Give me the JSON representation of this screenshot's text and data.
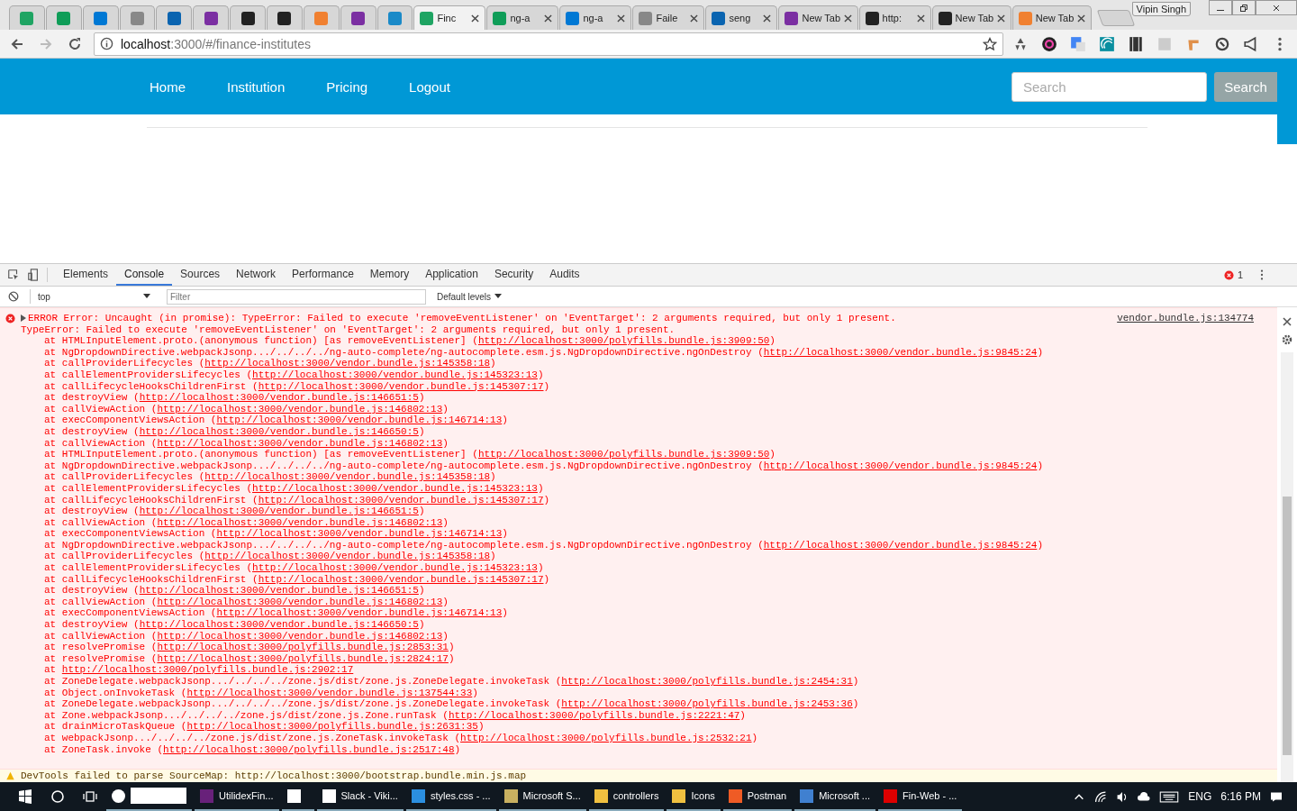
{
  "browser": {
    "tabs": [
      {
        "kind": "pinned",
        "selected": false
      },
      {
        "kind": "pinned",
        "selected": false
      },
      {
        "kind": "pinned",
        "selected": false
      },
      {
        "kind": "pinned",
        "selected": false
      },
      {
        "kind": "pinned",
        "selected": false
      },
      {
        "kind": "pinned",
        "selected": false
      },
      {
        "kind": "pinned",
        "selected": false
      },
      {
        "kind": "pinned",
        "selected": false
      },
      {
        "kind": "pinned",
        "selected": false
      },
      {
        "kind": "pinned",
        "selected": false
      },
      {
        "kind": "pinned",
        "selected": false
      },
      {
        "kind": "tab",
        "title": "Finc",
        "selected": true
      },
      {
        "kind": "tab",
        "title": "ng-a",
        "selected": false
      },
      {
        "kind": "tab",
        "title": "ng-a",
        "selected": false
      },
      {
        "kind": "tab",
        "title": "Faile",
        "selected": false
      },
      {
        "kind": "tab",
        "title": "seng",
        "selected": false
      },
      {
        "kind": "tab",
        "title": "New Tab",
        "selected": false
      },
      {
        "kind": "tab",
        "title": "http:",
        "selected": false
      },
      {
        "kind": "tab",
        "title": "New Tab",
        "selected": false
      },
      {
        "kind": "tab",
        "title": "New Tab",
        "selected": false
      }
    ],
    "profile": "Vipin Singh",
    "address": {
      "host": "localhost",
      "path": ":3000/#/finance-institutes"
    }
  },
  "page": {
    "nav": [
      "Home",
      "Institution",
      "Pricing",
      "Logout"
    ],
    "search": {
      "placeholder": "Search"
    },
    "search_button": "Search"
  },
  "devtools": {
    "tabs": [
      {
        "label": "Elements",
        "selected": false
      },
      {
        "label": "Console",
        "selected": true
      },
      {
        "label": "Sources",
        "selected": false
      },
      {
        "label": "Network",
        "selected": false
      },
      {
        "label": "Performance",
        "selected": false
      },
      {
        "label": "Memory",
        "selected": false
      },
      {
        "label": "Application",
        "selected": false
      },
      {
        "label": "Security",
        "selected": false
      },
      {
        "label": "Audits",
        "selected": false
      }
    ],
    "error_count": "1",
    "context": "top",
    "filter": {
      "placeholder": "Filter"
    },
    "levels": "Default levels",
    "error": {
      "summary": "ERROR Error: Uncaught (in promise): TypeError: Failed to execute 'removeEventListener' on 'EventTarget': 2 arguments required, but only 1 present.",
      "source": "vendor.bundle.js:134774",
      "message": "TypeError: Failed to execute 'removeEventListener' on 'EventTarget': 2 arguments required, but only 1 present.",
      "stack": [
        {
          "head": "at HTMLInputElement.proto.(anonymous function) [as removeEventListener] (",
          "link": "http://localhost:3000/polyfills.bundle.js:3909:50",
          "tail": ")"
        },
        {
          "head": "at NgDropdownDirective.webpackJsonp.../../../../ng-auto-complete/ng-autocomplete.esm.js.NgDropdownDirective.ngOnDestroy (",
          "link": "http://localhost:3000/vendor.bundle.js:9845:24",
          "tail": ")"
        },
        {
          "head": "at callProviderLifecycles (",
          "link": "http://localhost:3000/vendor.bundle.js:145358:18",
          "tail": ")"
        },
        {
          "head": "at callElementProvidersLifecycles (",
          "link": "http://localhost:3000/vendor.bundle.js:145323:13",
          "tail": ")"
        },
        {
          "head": "at callLifecycleHooksChildrenFirst (",
          "link": "http://localhost:3000/vendor.bundle.js:145307:17",
          "tail": ")"
        },
        {
          "head": "at destroyView (",
          "link": "http://localhost:3000/vendor.bundle.js:146651:5",
          "tail": ")"
        },
        {
          "head": "at callViewAction (",
          "link": "http://localhost:3000/vendor.bundle.js:146802:13",
          "tail": ")"
        },
        {
          "head": "at execComponentViewsAction (",
          "link": "http://localhost:3000/vendor.bundle.js:146714:13",
          "tail": ")"
        },
        {
          "head": "at destroyView (",
          "link": "http://localhost:3000/vendor.bundle.js:146650:5",
          "tail": ")"
        },
        {
          "head": "at callViewAction (",
          "link": "http://localhost:3000/vendor.bundle.js:146802:13",
          "tail": ")"
        },
        {
          "head": "at HTMLInputElement.proto.(anonymous function) [as removeEventListener] (",
          "link": "http://localhost:3000/polyfills.bundle.js:3909:50",
          "tail": ")"
        },
        {
          "head": "at NgDropdownDirective.webpackJsonp.../../../../ng-auto-complete/ng-autocomplete.esm.js.NgDropdownDirective.ngOnDestroy (",
          "link": "http://localhost:3000/vendor.bundle.js:9845:24",
          "tail": ")"
        },
        {
          "head": "at callProviderLifecycles (",
          "link": "http://localhost:3000/vendor.bundle.js:145358:18",
          "tail": ")"
        },
        {
          "head": "at callElementProvidersLifecycles (",
          "link": "http://localhost:3000/vendor.bundle.js:145323:13",
          "tail": ")"
        },
        {
          "head": "at callLifecycleHooksChildrenFirst (",
          "link": "http://localhost:3000/vendor.bundle.js:145307:17",
          "tail": ")"
        },
        {
          "head": "at destroyView (",
          "link": "http://localhost:3000/vendor.bundle.js:146651:5",
          "tail": ")"
        },
        {
          "head": "at callViewAction (",
          "link": "http://localhost:3000/vendor.bundle.js:146802:13",
          "tail": ")"
        },
        {
          "head": "at execComponentViewsAction (",
          "link": "http://localhost:3000/vendor.bundle.js:146714:13",
          "tail": ")"
        },
        {
          "head": "at NgDropdownDirective.webpackJsonp.../../../../ng-auto-complete/ng-autocomplete.esm.js.NgDropdownDirective.ngOnDestroy (",
          "link": "http://localhost:3000/vendor.bundle.js:9845:24",
          "tail": ")"
        },
        {
          "head": "at callProviderLifecycles (",
          "link": "http://localhost:3000/vendor.bundle.js:145358:18",
          "tail": ")"
        },
        {
          "head": "at callElementProvidersLifecycles (",
          "link": "http://localhost:3000/vendor.bundle.js:145323:13",
          "tail": ")"
        },
        {
          "head": "at callLifecycleHooksChildrenFirst (",
          "link": "http://localhost:3000/vendor.bundle.js:145307:17",
          "tail": ")"
        },
        {
          "head": "at destroyView (",
          "link": "http://localhost:3000/vendor.bundle.js:146651:5",
          "tail": ")"
        },
        {
          "head": "at callViewAction (",
          "link": "http://localhost:3000/vendor.bundle.js:146802:13",
          "tail": ")"
        },
        {
          "head": "at execComponentViewsAction (",
          "link": "http://localhost:3000/vendor.bundle.js:146714:13",
          "tail": ")"
        },
        {
          "head": "at destroyView (",
          "link": "http://localhost:3000/vendor.bundle.js:146650:5",
          "tail": ")"
        },
        {
          "head": "at callViewAction (",
          "link": "http://localhost:3000/vendor.bundle.js:146802:13",
          "tail": ")"
        },
        {
          "head": "at resolvePromise (",
          "link": "http://localhost:3000/polyfills.bundle.js:2853:31",
          "tail": ")"
        },
        {
          "head": "at resolvePromise (",
          "link": "http://localhost:3000/polyfills.bundle.js:2824:17",
          "tail": ")"
        },
        {
          "head": "at ",
          "link": "http://localhost:3000/polyfills.bundle.js:2902:17"
        },
        {
          "head": "at ZoneDelegate.webpackJsonp.../../../../zone.js/dist/zone.js.ZoneDelegate.invokeTask (",
          "link": "http://localhost:3000/polyfills.bundle.js:2454:31",
          "tail": ")"
        },
        {
          "head": "at Object.onInvokeTask (",
          "link": "http://localhost:3000/vendor.bundle.js:137544:33",
          "tail": ")"
        },
        {
          "head": "at ZoneDelegate.webpackJsonp.../../../../zone.js/dist/zone.js.ZoneDelegate.invokeTask (",
          "link": "http://localhost:3000/polyfills.bundle.js:2453:36",
          "tail": ")"
        },
        {
          "head": "at Zone.webpackJsonp.../../../../zone.js/dist/zone.js.Zone.runTask (",
          "link": "http://localhost:3000/polyfills.bundle.js:2221:47",
          "tail": ")"
        },
        {
          "head": "at drainMicroTaskQueue (",
          "link": "http://localhost:3000/polyfills.bundle.js:2631:35",
          "tail": ")"
        },
        {
          "head": "at webpackJsonp.../../../../zone.js/dist/zone.js.ZoneTask.invokeTask (",
          "link": "http://localhost:3000/polyfills.bundle.js:2532:21",
          "tail": ")"
        },
        {
          "head": "at ZoneTask.invoke (",
          "link": "http://localhost:3000/polyfills.bundle.js:2517:48",
          "tail": ")"
        }
      ]
    },
    "warning": "DevTools failed to parse SourceMap: http://localhost:3000/bootstrap.bundle.min.js.map"
  },
  "taskbar": {
    "apps": [
      {
        "kind": "blank"
      },
      {
        "kind": "app",
        "label": "UtilidexFin..."
      },
      {
        "kind": "icon"
      },
      {
        "kind": "app",
        "label": "Slack - Viki..."
      },
      {
        "kind": "app",
        "label": "styles.css - ..."
      },
      {
        "kind": "app",
        "label": "Microsoft S..."
      },
      {
        "kind": "app",
        "label": "controllers"
      },
      {
        "kind": "app",
        "label": "Icons"
      },
      {
        "kind": "app",
        "label": "Postman"
      },
      {
        "kind": "app",
        "label": "Microsoft ..."
      },
      {
        "kind": "app",
        "label": "Fin-Web - ..."
      }
    ],
    "lang": "ENG",
    "time": "6:16 PM"
  }
}
